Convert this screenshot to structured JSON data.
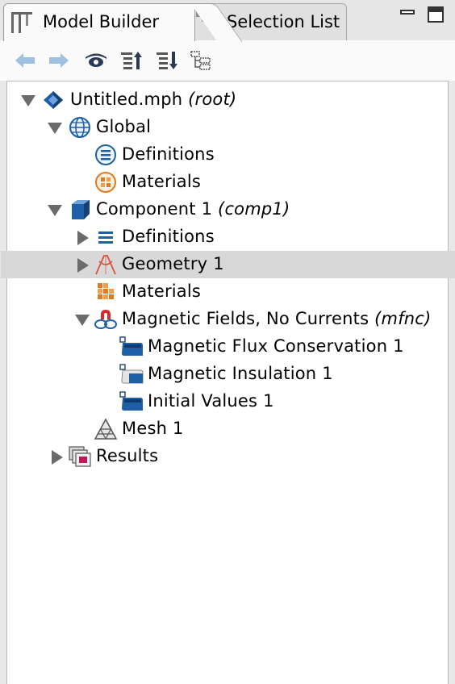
{
  "tabs": {
    "model_builder": "Model Builder",
    "selection_list": "Selection List"
  },
  "toolbar": {
    "items": [
      "back-arrow",
      "forward-arrow",
      "show-icon",
      "collapse-up-icon",
      "expand-down-icon",
      "tree-view-icon"
    ]
  },
  "tree": {
    "root": {
      "label": "Untitled.mph",
      "tag": "(root)"
    },
    "global": {
      "label": "Global"
    },
    "global_definitions": {
      "label": "Definitions"
    },
    "global_materials": {
      "label": "Materials"
    },
    "component": {
      "label": "Component 1",
      "tag": "(comp1)"
    },
    "comp_definitions": {
      "label": "Definitions"
    },
    "geometry": {
      "label": "Geometry 1"
    },
    "comp_materials": {
      "label": "Materials"
    },
    "physics": {
      "label": "Magnetic Fields, No Currents",
      "tag": "(mfnc)"
    },
    "flux_conservation": {
      "label": "Magnetic Flux Conservation 1"
    },
    "insulation": {
      "label": "Magnetic Insulation 1"
    },
    "initial_values": {
      "label": "Initial Values 1"
    },
    "mesh": {
      "label": "Mesh 1"
    },
    "results": {
      "label": "Results"
    }
  },
  "colors": {
    "selected_row": "#d8d8d8",
    "icon_blue": "#1f5fa8",
    "icon_orange": "#e07a1e",
    "geometry_red": "#d9533f"
  }
}
